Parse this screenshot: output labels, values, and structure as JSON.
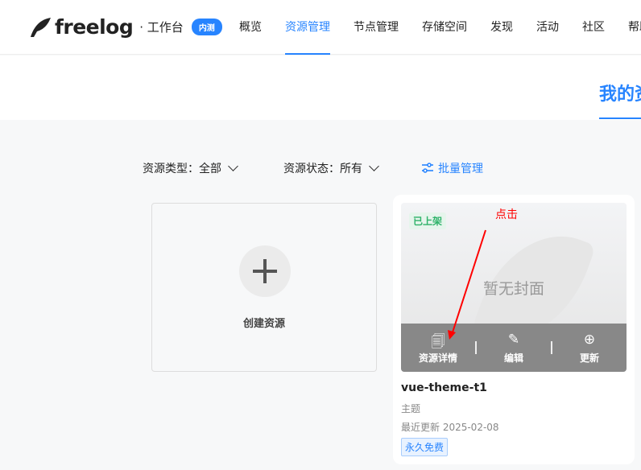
{
  "header": {
    "logo": "freelog",
    "workspace": "· 工作台",
    "badge": "内测",
    "nav": [
      "概览",
      "资源管理",
      "节点管理",
      "存储空间",
      "发现",
      "活动",
      "社区",
      "帮助"
    ],
    "active_index": 1
  },
  "page_title": "我的资源",
  "filters": {
    "type_label": "资源类型：全部",
    "status_label": "资源状态：所有",
    "batch": "批量管理"
  },
  "create": {
    "label": "创建资源"
  },
  "card": {
    "status": "已上架",
    "cover_placeholder": "暂无封面",
    "actions": [
      "资源详情",
      "编辑",
      "更新"
    ],
    "name": "vue-theme-t1",
    "type": "主题",
    "updated": "最近更新 2025-02-08",
    "price": "永久免费"
  },
  "annotation": "点击",
  "colors": {
    "accent": "#2784ff",
    "annotation": "#ff0000"
  }
}
